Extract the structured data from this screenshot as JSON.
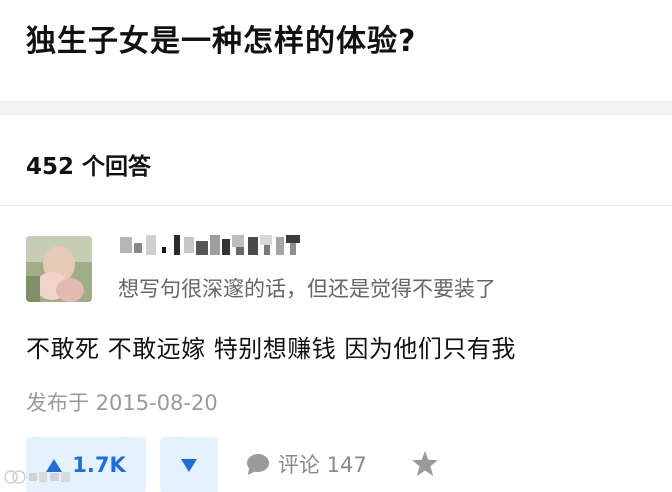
{
  "question": {
    "title": "独生子女是一种怎样的体验?"
  },
  "answers": {
    "count_label": "452 个回答",
    "items": [
      {
        "author_bio": "想写句很深邃的话，但还是觉得不要装了",
        "content": "不敢死 不敢远嫁 特别想赚钱 因为他们只有我",
        "publish_date": "发布于 2015-08-20",
        "upvote_count": "1.7K",
        "comment_label": "评论 147"
      }
    ]
  },
  "icons": {
    "upvote": "triangle-up-icon",
    "downvote": "triangle-down-icon",
    "comment": "comment-bubble-icon",
    "favorite": "star-icon"
  },
  "colors": {
    "accent": "#1e6fd9",
    "vote_background": "#e5f1ff",
    "secondary_text": "#8a8a8a",
    "page_background": "#f3f3f5"
  }
}
